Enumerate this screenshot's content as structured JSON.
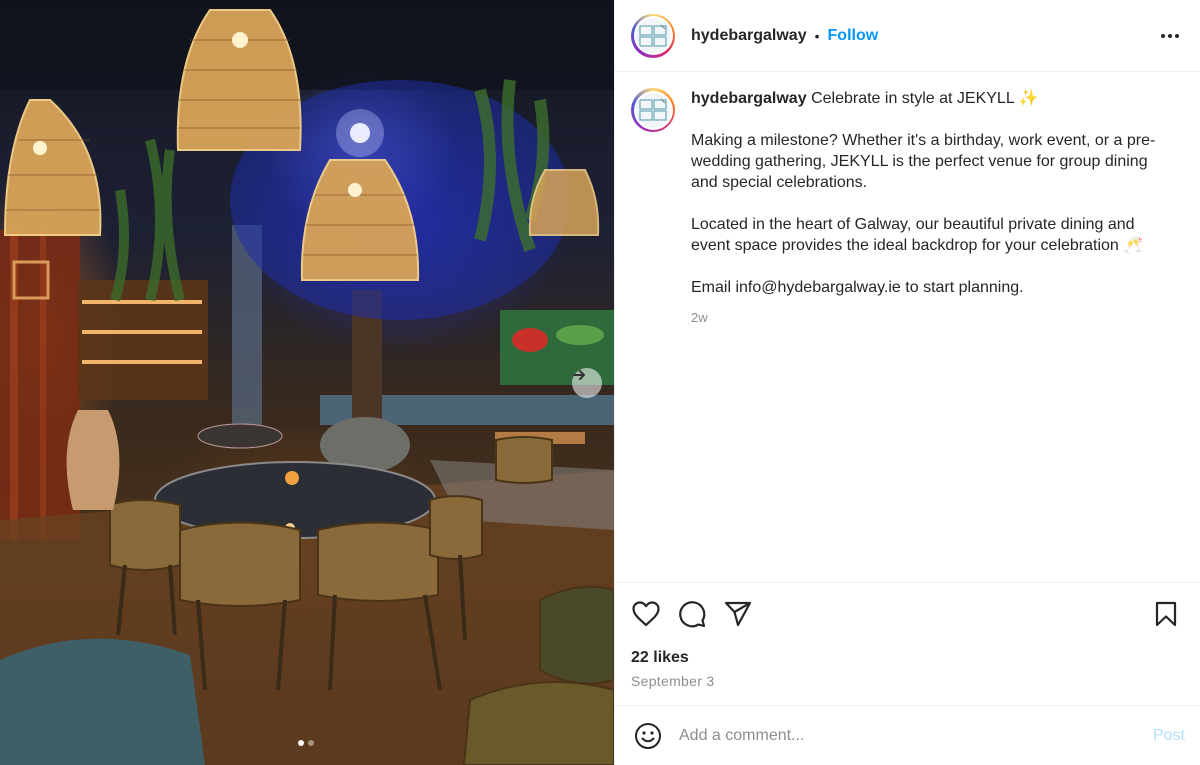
{
  "photo": {
    "alt": "",
    "carousel_total": 2,
    "carousel_index": 1
  },
  "header": {
    "username": "hydebargalway",
    "separator": "•",
    "follow_label": "Follow",
    "more_icon": "more-horizontal-icon"
  },
  "caption": {
    "username": "hydebargalway",
    "headline": "Celebrate in style at JEKYLL",
    "headline_emoji": "✨",
    "paragraph_1": "Making a milestone? Whether it's a birthday, work event, or a pre-wedding gathering, JEKYLL is the perfect venue for group dining and special celebrations.",
    "paragraph_2": "Located in the heart of Galway, our beautiful private dining and event space provides the ideal backdrop for your celebration",
    "paragraph_2_emoji": "🥂",
    "paragraph_3": "Email info@hydebargalway.ie to start planning.",
    "time_ago": "2w"
  },
  "actions": {
    "like_icon": "heart-icon",
    "comment_icon": "comment-icon",
    "share_icon": "paper-plane-icon",
    "save_icon": "bookmark-icon"
  },
  "likes": "22 likes",
  "date": "September 3",
  "comment": {
    "placeholder": "Add a comment...",
    "post_label": "Post",
    "emoji_icon": "smiley-icon"
  },
  "colors": {
    "accent": "#0095f6",
    "post_disabled": "#b2dffc",
    "muted": "#8e8e8e",
    "text": "#262626"
  }
}
